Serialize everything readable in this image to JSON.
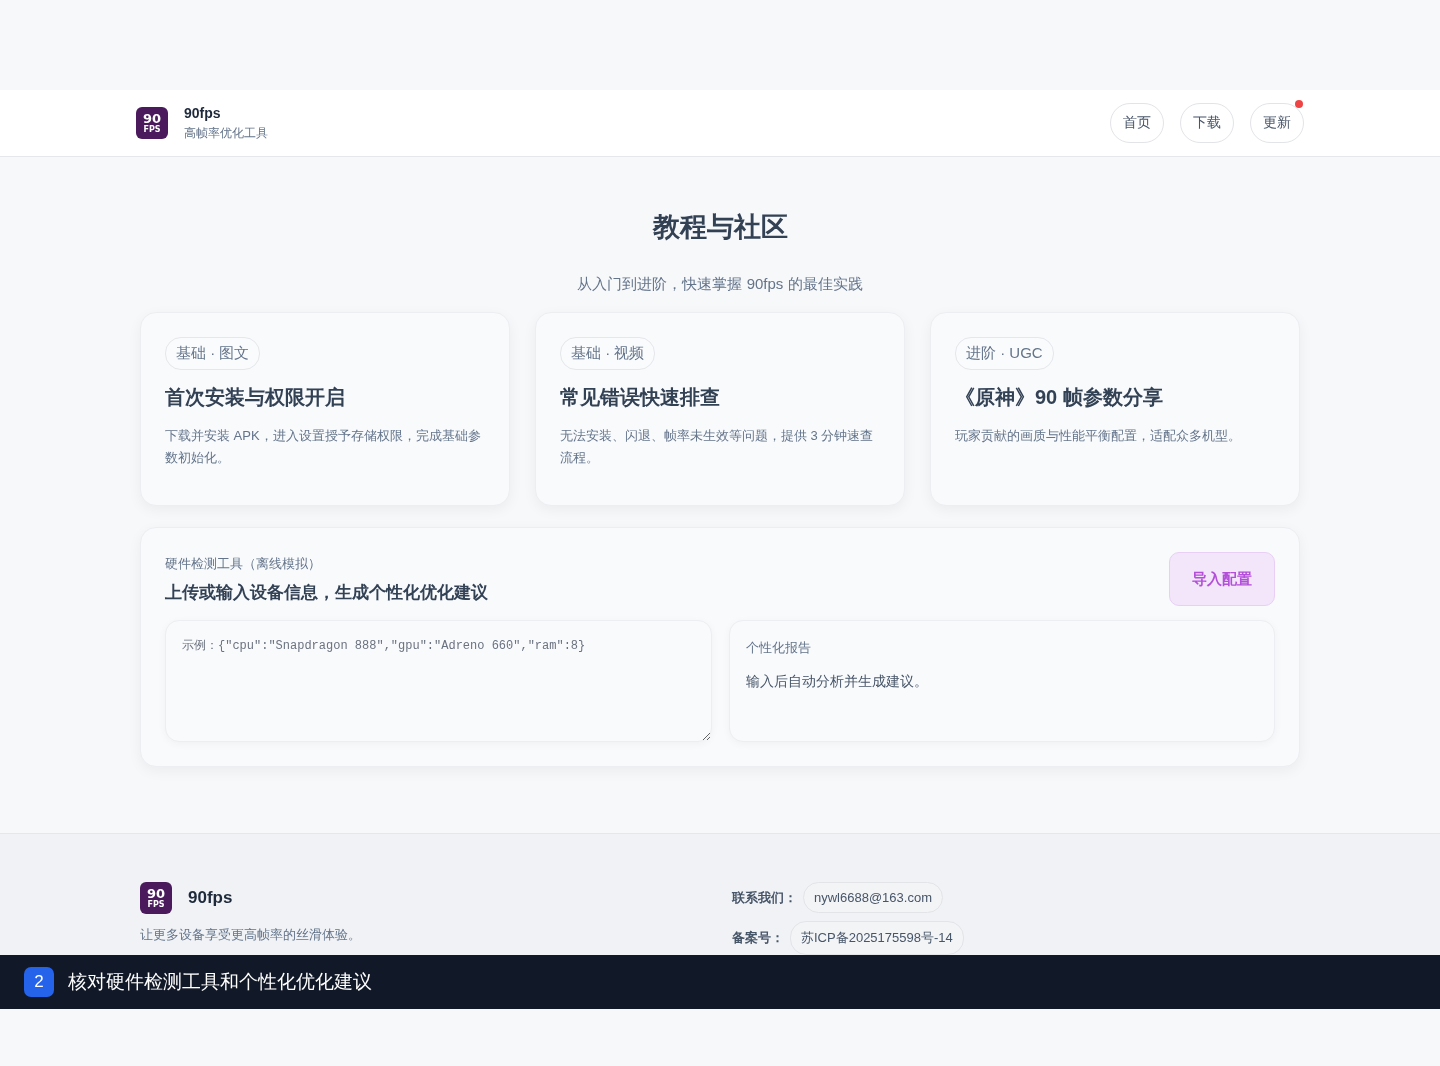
{
  "header": {
    "logo_text": "90",
    "logo_subtext": "FPS",
    "brand": "90fps",
    "tagline": "高帧率优化工具",
    "nav": [
      {
        "label": "首页",
        "badge": false
      },
      {
        "label": "下载",
        "badge": false
      },
      {
        "label": "更新",
        "badge": true
      }
    ]
  },
  "section": {
    "title": "教程与社区",
    "subtitle": "从入门到进阶，快速掌握 90fps 的最佳实践"
  },
  "cards": [
    {
      "tag": "基础 · 图文",
      "title": "首次安装与权限开启",
      "text": "下载并安装 APK，进入设置授予存储权限，完成基础参数初始化。"
    },
    {
      "tag": "基础 · 视频",
      "title": "常见错误快速排查",
      "text": "无法安装、闪退、帧率未生效等问题，提供 3 分钟速查流程。"
    },
    {
      "tag": "进阶 · UGC",
      "title": "《原神》90 帧参数分享",
      "text": "玩家贡献的画质与性能平衡配置，适配众多机型。"
    }
  ],
  "tool": {
    "eyebrow": "硬件检测工具（离线模拟）",
    "title": "上传或输入设备信息，生成个性化优化建议",
    "button": "导入配置",
    "input": {
      "placeholder": "示例：{\"cpu\":\"Snapdragon 888\",\"gpu\":\"Adreno 660\",\"ram\":8}"
    },
    "report": {
      "label": "个性化报告",
      "text": "输入后自动分析并生成建议。"
    }
  },
  "footer": {
    "logo_text": "90",
    "logo_subtext": "FPS",
    "brand": "90fps",
    "slogan": "让更多设备享受更高帧率的丝滑体验。",
    "contacts": [
      {
        "label": "联系我们：",
        "value": "nywl6688@163.com"
      },
      {
        "label": "备案号：",
        "value": "苏ICP备2025175598号-14"
      }
    ]
  },
  "caption": {
    "step": "2",
    "text": "核对硬件检测工具和个性化优化建议"
  }
}
